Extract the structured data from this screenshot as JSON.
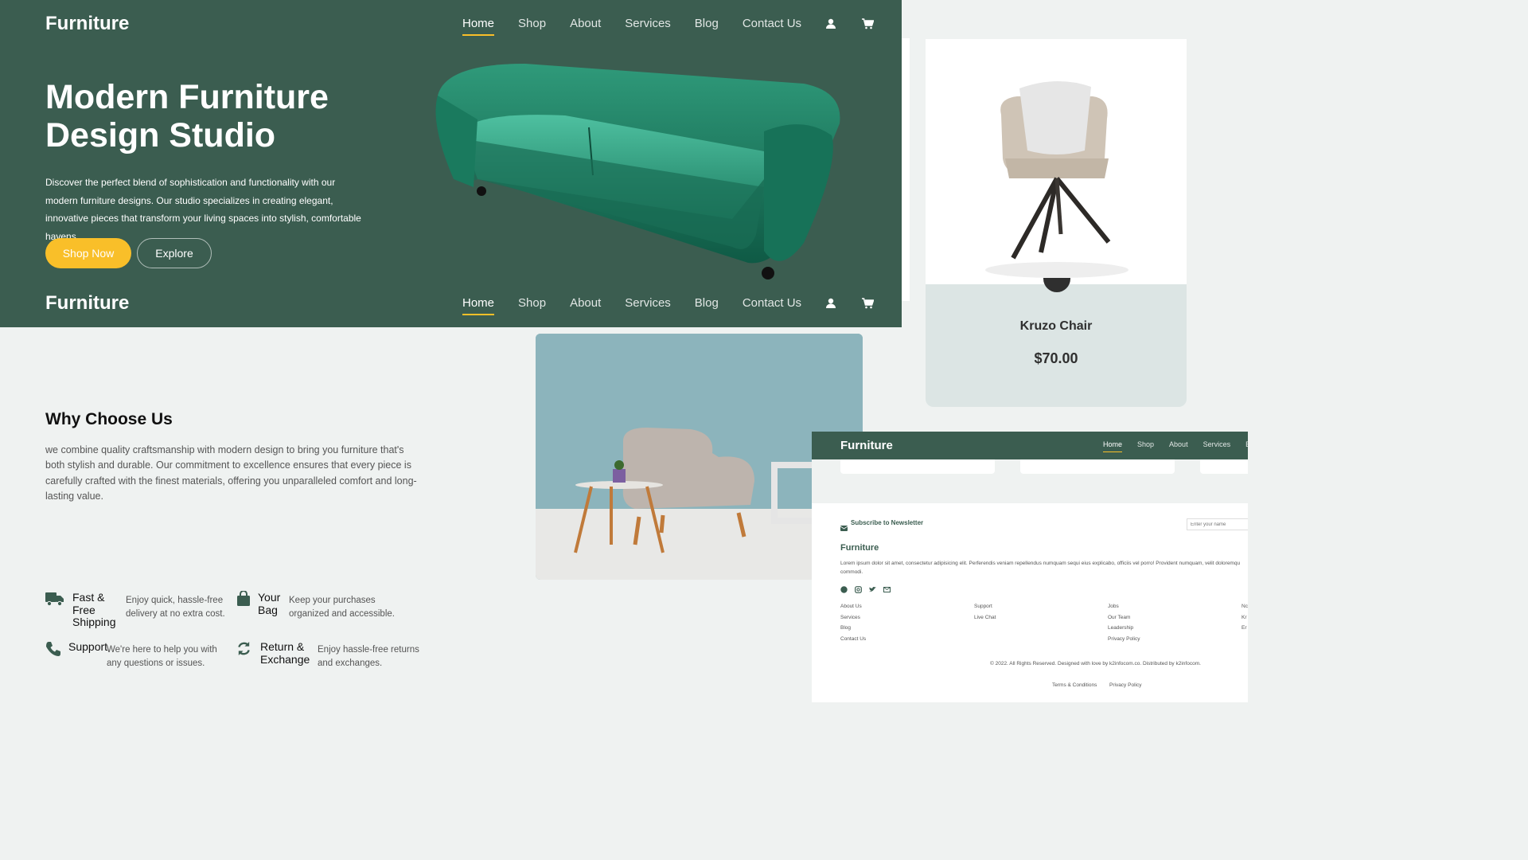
{
  "brand": "Furniture",
  "nav": {
    "items": [
      "Home",
      "Shop",
      "About",
      "Services",
      "Blog",
      "Contact Us"
    ],
    "active": "Home"
  },
  "hero": {
    "title": "Modern Furniture Design Studio",
    "description": "Discover the perfect blend of sophistication and functionality with our modern furniture designs. Our studio specializes in creating elegant, innovative pieces that transform your living spaces into stylish, comfortable havens.",
    "primary_button": "Shop Now",
    "secondary_button": "Explore"
  },
  "product": {
    "name": "Kruzo Chair",
    "price": "$70.00"
  },
  "why": {
    "title": "Why Choose Us",
    "text": "we combine quality craftsmanship with modern design to bring you furniture that's both stylish and durable. Our commitment to excellence ensures that every piece is carefully crafted with the finest materials, offering you unparalleled comfort and long-lasting value.",
    "features": [
      {
        "title": "Fast & Free Shipping",
        "text": "Enjoy quick, hassle-free delivery at no extra cost.",
        "icon": "truck-icon"
      },
      {
        "title": "Your Bag",
        "text": "Keep your purchases organized and accessible.",
        "icon": "bag-icon"
      },
      {
        "title": "Support",
        "text": "We're here to help you with any questions or issues.",
        "icon": "phone-icon"
      },
      {
        "title": "Return & Exchange",
        "text": "Enjoy hassle-free returns and exchanges.",
        "icon": "refresh-icon"
      }
    ]
  },
  "mini": {
    "nav_items": [
      "Home",
      "Shop",
      "About",
      "Services",
      "Bl"
    ],
    "newsletter_label": "Subscribe to Newsletter",
    "newsletter_placeholder": "Enter your name",
    "footer_brand": "Furniture",
    "footer_text": "Lorem ipsum dolor sit amet, consectetur adipisicing elit. Perferendis veniam repellendus numquam sequi eius explicabo, officiis vel porro! Provident numquam, velit doloremqu",
    "footer_text2": "commodi.",
    "col1": [
      "About Us",
      "Services",
      "Blog",
      "Contact Us"
    ],
    "col2": [
      "Support",
      "Live Chat"
    ],
    "col3": [
      "Jobs",
      "Our Team",
      "Leadership",
      "Privacy Policy"
    ],
    "col4": [
      "Nc",
      "Kr",
      "Er"
    ],
    "copyright": "© 2022. All Rights Reserved. Designed with love by k2infocom.co. Distributed by k2infocom.",
    "terms": "Terms & Conditions",
    "privacy": "Privacy Policy"
  },
  "colors": {
    "primary": "#3b5d50",
    "accent": "#f9bf29",
    "background": "#eff2f1"
  }
}
